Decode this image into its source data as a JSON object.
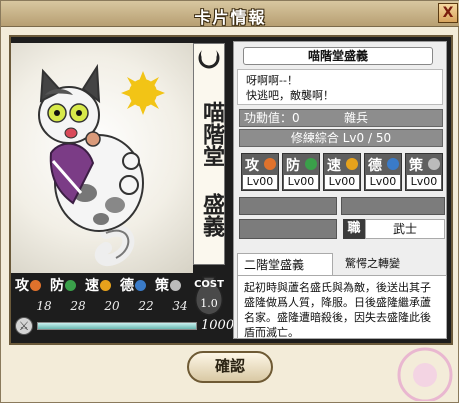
{
  "window": {
    "title": "卡片情報",
    "close_label": "X"
  },
  "card": {
    "name_vertical": "喵階堂 盛義",
    "cost_label": "COST",
    "cost_value": "1.0",
    "hp_value": "1000",
    "hp_fraction": 1.0,
    "stats": [
      {
        "key": "攻",
        "icon": "attack-icon",
        "color": "#e0722c",
        "value": "18"
      },
      {
        "key": "防",
        "icon": "defense-icon",
        "color": "#3aa04a",
        "value": "28"
      },
      {
        "key": "速",
        "icon": "speed-icon",
        "color": "#e6a21c",
        "value": "20"
      },
      {
        "key": "德",
        "icon": "virtue-icon",
        "color": "#3a7bc8",
        "value": "22"
      },
      {
        "key": "策",
        "icon": "strategy-icon",
        "color": "#bbbbbb",
        "value": "34"
      }
    ]
  },
  "info": {
    "name": "喵階堂盛義",
    "quote_line1": "呀啊啊--！",
    "quote_line2": "快逃吧，敵襲啊！",
    "merit_label": "功勳值：0",
    "rank": "雜兵",
    "training_label": "修練綜合",
    "training_value": "Lv0 / 50",
    "levels": [
      {
        "key": "攻",
        "color": "#e0722c",
        "value": "Lv00"
      },
      {
        "key": "防",
        "color": "#3aa04a",
        "value": "Lv00"
      },
      {
        "key": "速",
        "color": "#e6a21c",
        "value": "Lv00"
      },
      {
        "key": "德",
        "color": "#3a7bc8",
        "value": "Lv00"
      },
      {
        "key": "策",
        "color": "#bbbbbb",
        "value": "Lv00"
      }
    ],
    "job_label": "職",
    "job_value": "武士",
    "skill_owner": "二階堂盛義",
    "skill_name": "驚愕之轉變",
    "description": "起初時與蘆名盛氏與為敵，後送出其子盛隆做爲人質，降服。日後盛隆繼承蘆名家。盛隆遭暗殺後，因失去盛隆此後盾而滅亡。"
  },
  "buttons": {
    "confirm": "確認"
  }
}
